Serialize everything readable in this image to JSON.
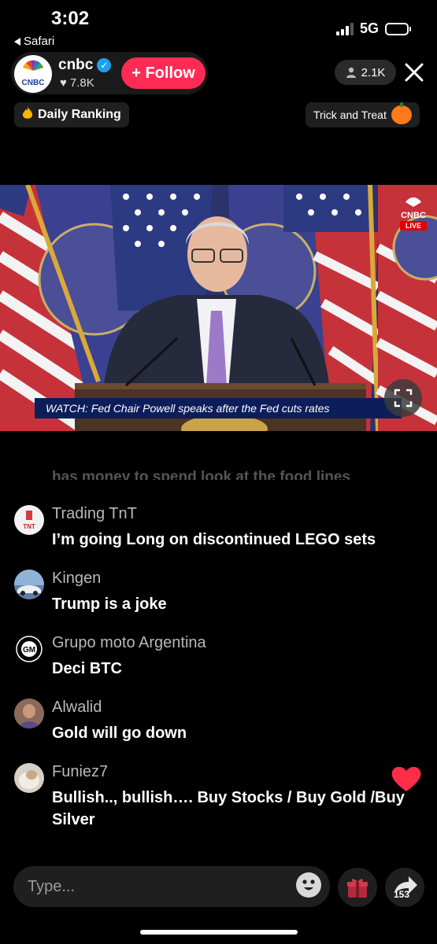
{
  "status": {
    "time": "3:02",
    "back_app": "Safari",
    "network": "5G"
  },
  "host": {
    "name": "cnbc",
    "likes": "7.8K",
    "follow_label": "+ Follow",
    "viewers": "2.1K",
    "logo_text": "CNBC"
  },
  "chips": {
    "daily_ranking": "Daily Ranking",
    "trick_and_treat": "Trick and Treat"
  },
  "video": {
    "caption": "WATCH: Fed Chair Powell speaks after the Fed cuts rates",
    "bug_logo": "CNBC",
    "bug_live": "LIVE"
  },
  "comments": {
    "faded_partial": "has money to spend look at the food lines",
    "items": [
      {
        "user": "Trading TnT",
        "message": "I’m going Long on discontinued LEGO sets",
        "avatar_text": "TNT"
      },
      {
        "user": "Kingen",
        "message": "Trump is a joke"
      },
      {
        "user": "Grupo moto Argentina",
        "message": "Deci BTC",
        "avatar_text": "GM"
      },
      {
        "user": "Alwalid",
        "message": "Gold will go down"
      },
      {
        "user": "Funiez7",
        "message": "Bullish.., bullish…. Buy Stocks / Buy Gold /Buy Silver"
      }
    ]
  },
  "composer": {
    "placeholder": "Type...",
    "share_count": "153"
  },
  "colors": {
    "follow": "#fe2c55",
    "verified": "#1da1f2",
    "heart": "#ff2d48",
    "caption_bar": "#0c1e5a"
  }
}
